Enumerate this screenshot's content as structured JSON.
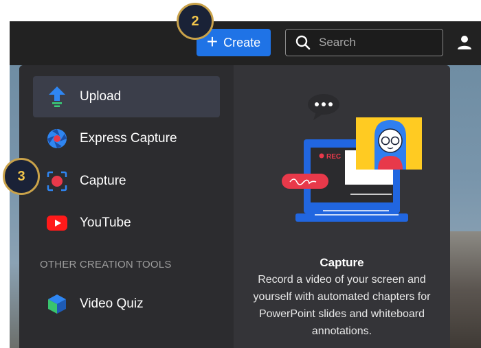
{
  "topbar": {
    "create_label": "Create",
    "search_placeholder": "Search"
  },
  "menu": {
    "items": [
      {
        "label": "Upload",
        "icon": "upload-icon"
      },
      {
        "label": "Express Capture",
        "icon": "express-capture-icon"
      },
      {
        "label": "Capture",
        "icon": "capture-icon"
      },
      {
        "label": "YouTube",
        "icon": "youtube-icon"
      }
    ],
    "section_label": "OTHER CREATION TOOLS",
    "other_tools": [
      {
        "label": "Video Quiz",
        "icon": "video-quiz-icon"
      }
    ]
  },
  "preview": {
    "title": "Capture",
    "description": "Record a video of your screen and yourself with automated chapters for PowerPoint slides and whiteboard annotations.",
    "rec_label": "REC"
  },
  "badges": {
    "step2": "2",
    "step3": "3"
  },
  "colors": {
    "accent": "#1f73e6",
    "badge_border": "#c9a24a",
    "badge_text": "#f2c54b",
    "rec_red": "#e8394a",
    "youtube_red": "#ff1a1a"
  }
}
